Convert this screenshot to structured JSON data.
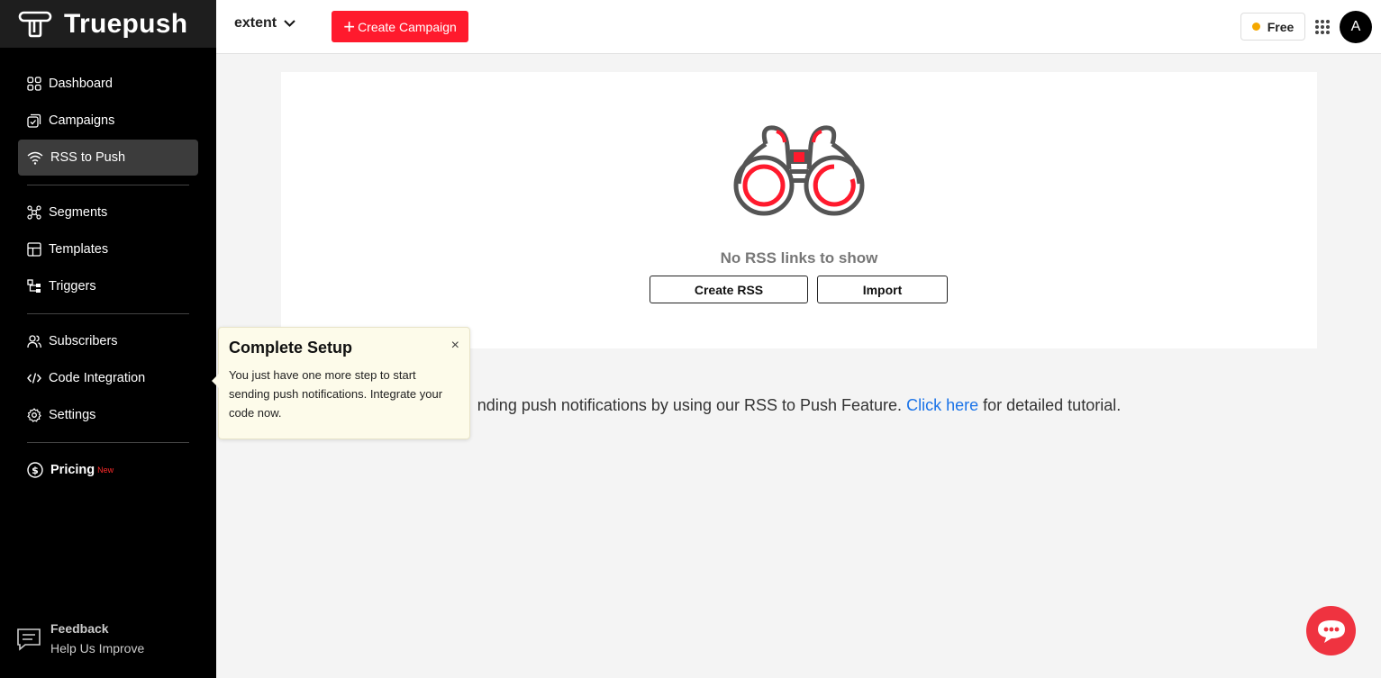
{
  "brand": {
    "name": "Truepush"
  },
  "sidebar": {
    "items": [
      {
        "label": "Dashboard",
        "icon": "dashboard-icon"
      },
      {
        "label": "Campaigns",
        "icon": "campaigns-icon"
      },
      {
        "label": "RSS to Push",
        "icon": "rss-icon",
        "active": true
      },
      {
        "label": "Segments",
        "icon": "segments-icon"
      },
      {
        "label": "Templates",
        "icon": "templates-icon"
      },
      {
        "label": "Triggers",
        "icon": "triggers-icon"
      },
      {
        "label": "Subscribers",
        "icon": "subscribers-icon"
      },
      {
        "label": "Code Integration",
        "icon": "code-icon"
      },
      {
        "label": "Settings",
        "icon": "gear-icon"
      },
      {
        "label": "Pricing",
        "icon": "dollar-icon",
        "badge": "New"
      }
    ],
    "feedback": {
      "title": "Feedback",
      "subtitle": "Help Us Improve"
    }
  },
  "topbar": {
    "project": "extent",
    "create_label": "Create Campaign",
    "plan": "Free",
    "avatar_initial": "A"
  },
  "main": {
    "empty_text": "No RSS links to show",
    "create_rss_label": "Create RSS",
    "import_label": "Import",
    "help_prefix": "nding push notifications by using our RSS to Push Feature.",
    "help_link": "Click here",
    "help_suffix": "for detailed tutorial."
  },
  "tooltip": {
    "title": "Complete Setup",
    "close": "×",
    "body": "You just have one more step to start sending push notifications. Integrate your code now."
  },
  "colors": {
    "accent": "#ff1a2d",
    "sidebar_bg": "#000000",
    "link": "#1a73e8",
    "plan_dot": "#f5a800"
  }
}
